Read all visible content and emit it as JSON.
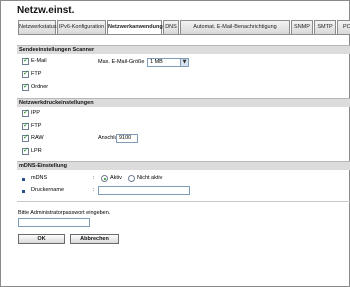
{
  "page_title": "Netzw.einst.",
  "tabs": [
    {
      "label": "Netzwerkstatus"
    },
    {
      "label": "IPv6-Konfiguration"
    },
    {
      "label": "Netzwerkanwendung"
    },
    {
      "label": "DNS"
    },
    {
      "label": "Automat. E-Mail-Benachrichtigung"
    },
    {
      "label": "SNMP"
    },
    {
      "label": "SMTP"
    },
    {
      "label": "PO"
    }
  ],
  "active_tab": "Netzwerkanwendung",
  "scanner_section": {
    "title": "Sendeeinstellungen Scanner",
    "email_label": "E-Mail",
    "max_email_size_label": "Max. E-Mail-Größe",
    "max_email_size_value": "1 MB",
    "ftp_label": "FTP",
    "folder_label": "Ordner"
  },
  "print_section": {
    "title": "Netzwerkdruckeinstellungen",
    "ipp_label": "IPP",
    "ftp_label": "FTP",
    "raw_label": "RAW",
    "port_label": "Anschluss",
    "port_value": "9100",
    "lpr_label": "LPR"
  },
  "mdns_section": {
    "title": "mDNS-Einstellung",
    "mdns_label": "mDNS",
    "separator": ":",
    "active_label": "Aktiv",
    "inactive_label": "Nicht aktiv",
    "printer_name_label": "Druckername",
    "printer_name_separator": ":",
    "printer_name_value": ""
  },
  "admin": {
    "password_prompt": "Bitte Administratorpasswort eingeben.",
    "password_value": ""
  },
  "buttons": {
    "ok": "OK",
    "cancel": "Abbrechen"
  },
  "colors": {
    "accent_check": "#1b8a1b",
    "bullet": "#2a4f8c",
    "section_bg": "#dcdcdc"
  }
}
